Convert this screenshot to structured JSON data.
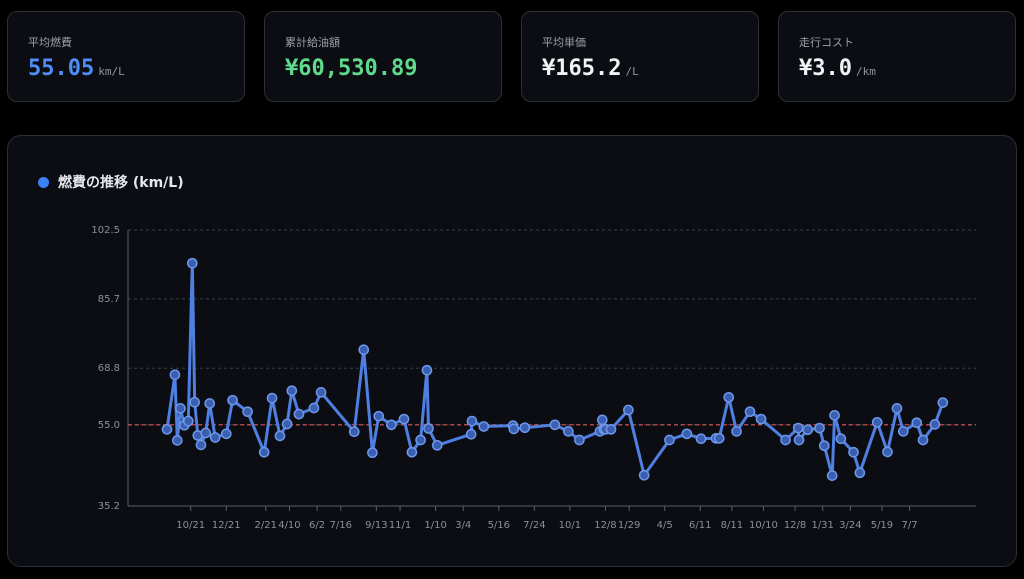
{
  "stats": [
    {
      "label": "平均燃費",
      "value": "55.05",
      "unit": "km/L",
      "color": "#4f8ef7"
    },
    {
      "label": "累計給油額",
      "value": "¥60,530.89",
      "unit": "",
      "color": "#5fd98b"
    },
    {
      "label": "平均単価",
      "value": "¥165.2",
      "unit": "/L",
      "color": "#f0f2f6"
    },
    {
      "label": "走行コスト",
      "value": "¥3.0",
      "unit": "/km",
      "color": "#f0f2f6"
    }
  ],
  "chart_data": {
    "type": "line",
    "title": "燃費の推移 (km/L)",
    "legend_color": "#3b82f6",
    "ylim": [
      35.2,
      102.5
    ],
    "yticks": [
      "35.2",
      "55.0",
      "68.8",
      "85.7",
      "102.5"
    ],
    "ytick_values": [
      35.2,
      55.0,
      68.8,
      85.7,
      102.5
    ],
    "grid": "dashed horizontal",
    "xlim": [
      0,
      108
    ],
    "xtick_labels": [
      {
        "x": 3,
        "label": "10/21"
      },
      {
        "x": 7.5,
        "label": "12/21"
      },
      {
        "x": 12.5,
        "label": "2/21"
      },
      {
        "x": 15.5,
        "label": "4/10"
      },
      {
        "x": 19,
        "label": "6/2"
      },
      {
        "x": 22,
        "label": "7/16"
      },
      {
        "x": 26.5,
        "label": "9/13"
      },
      {
        "x": 29.5,
        "label": "11/1"
      },
      {
        "x": 34,
        "label": "1/10"
      },
      {
        "x": 37.5,
        "label": "3/4"
      },
      {
        "x": 42,
        "label": "5/16"
      },
      {
        "x": 46.5,
        "label": "7/24"
      },
      {
        "x": 51,
        "label": "10/1"
      },
      {
        "x": 55.5,
        "label": "12/8"
      },
      {
        "x": 58.5,
        "label": "1/29"
      },
      {
        "x": 63,
        "label": "4/5"
      },
      {
        "x": 67.5,
        "label": "6/11"
      },
      {
        "x": 71.5,
        "label": "8/11"
      },
      {
        "x": 75.5,
        "label": "10/10"
      },
      {
        "x": 79.5,
        "label": "12/8"
      },
      {
        "x": 83,
        "label": "1/31"
      },
      {
        "x": 86.5,
        "label": "3/24"
      },
      {
        "x": 90.5,
        "label": "5/19"
      },
      {
        "x": 94,
        "label": "7/7"
      }
    ],
    "reference_line": {
      "value": 55.0,
      "color": "#e05252",
      "style": "dashed"
    },
    "series": [
      {
        "color": "#4f7fe0",
        "points": [
          [
            0,
            53.9
          ],
          [
            1,
            67.2
          ],
          [
            1.3,
            51.2
          ],
          [
            1.7,
            59.0
          ],
          [
            2.2,
            54.9
          ],
          [
            2.7,
            55.9
          ],
          [
            3.2,
            94.4
          ],
          [
            3.5,
            60.5
          ],
          [
            3.9,
            52.4
          ],
          [
            4.3,
            50.1
          ],
          [
            4.9,
            53.0
          ],
          [
            5.4,
            60.2
          ],
          [
            6.1,
            51.9
          ],
          [
            7.5,
            52.8
          ],
          [
            8.3,
            61.0
          ],
          [
            10.2,
            58.2
          ],
          [
            12.3,
            48.3
          ],
          [
            13.3,
            61.5
          ],
          [
            14.3,
            52.3
          ],
          [
            15.2,
            55.2
          ],
          [
            15.8,
            63.3
          ],
          [
            16.7,
            57.6
          ],
          [
            18.6,
            59.1
          ],
          [
            19.5,
            62.9
          ],
          [
            23.7,
            53.3
          ],
          [
            24.9,
            73.3
          ],
          [
            26,
            48.2
          ],
          [
            26.8,
            57.1
          ],
          [
            28.4,
            55.0
          ],
          [
            30,
            56.4
          ],
          [
            31,
            48.3
          ],
          [
            32.1,
            51.3
          ],
          [
            32.9,
            68.3
          ],
          [
            33.1,
            54.1
          ],
          [
            34.2,
            50.0
          ],
          [
            38.5,
            52.7
          ],
          [
            38.6,
            55.9
          ],
          [
            40.1,
            54.6
          ],
          [
            43.8,
            54.8
          ],
          [
            43.9,
            54.0
          ],
          [
            45.3,
            54.3
          ],
          [
            49.1,
            55.0
          ],
          [
            50.8,
            53.4
          ],
          [
            52.2,
            51.3
          ],
          [
            54.8,
            53.4
          ],
          [
            55.1,
            56.2
          ],
          [
            55.3,
            53.9
          ],
          [
            55.5,
            53.9
          ],
          [
            56.2,
            53.9
          ],
          [
            58.4,
            58.6
          ],
          [
            60.4,
            42.7
          ],
          [
            63.6,
            51.3
          ],
          [
            65.8,
            52.8
          ],
          [
            67.6,
            51.6
          ],
          [
            69.5,
            51.7
          ],
          [
            69.9,
            51.7
          ],
          [
            71.1,
            61.7
          ],
          [
            72.1,
            53.4
          ],
          [
            73.8,
            58.2
          ],
          [
            75.2,
            56.4
          ],
          [
            78.3,
            51.3
          ],
          [
            79.9,
            54.2
          ],
          [
            80,
            51.3
          ],
          [
            81.1,
            53.8
          ],
          [
            82.6,
            54.2
          ],
          [
            83.2,
            49.9
          ],
          [
            84.2,
            42.6
          ],
          [
            84.5,
            57.3
          ],
          [
            85.3,
            51.6
          ],
          [
            86.9,
            48.3
          ],
          [
            87.7,
            43.3
          ],
          [
            89.9,
            55.6
          ],
          [
            91.2,
            48.4
          ],
          [
            92.4,
            59.0
          ],
          [
            93.2,
            53.4
          ],
          [
            94.9,
            55.5
          ],
          [
            95.7,
            51.3
          ],
          [
            97.2,
            55.1
          ],
          [
            98.2,
            60.4
          ]
        ]
      }
    ]
  }
}
